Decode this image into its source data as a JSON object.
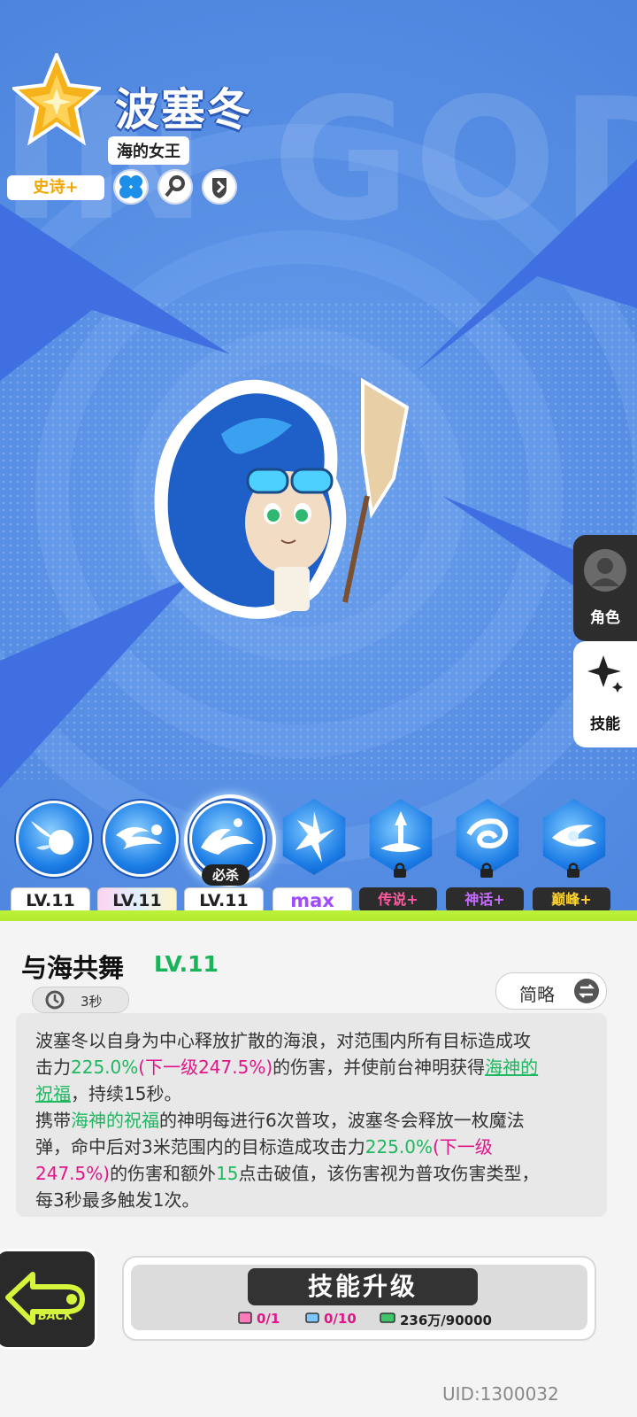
{
  "hero": {
    "name": "波塞冬",
    "title": "海的女王",
    "rarity": "史诗+",
    "watermark": "IN GOD",
    "traits": [
      "clover-icon",
      "key-icon",
      "shield-icon"
    ]
  },
  "side_tabs": [
    {
      "label": "角色",
      "active": false
    },
    {
      "label": "技能",
      "active": true
    }
  ],
  "skills": [
    {
      "icon": "comet-skill-icon",
      "shape": "circle",
      "level_label": "LV.11",
      "locked": false,
      "selected": false
    },
    {
      "icon": "wave-skill-icon",
      "shape": "circle",
      "level_label": "LV.11",
      "locked": false,
      "selected": false
    },
    {
      "icon": "sea-dance-skill-icon",
      "shape": "circle",
      "level_label": "LV.11",
      "locked": false,
      "selected": true,
      "tag": "必杀"
    },
    {
      "icon": "trident-burst-skill-icon",
      "shape": "hex",
      "level_label": "max",
      "locked": false,
      "selected": false
    },
    {
      "icon": "fountain-skill-icon",
      "shape": "hex",
      "level_label": "传说+",
      "locked": true,
      "selected": false
    },
    {
      "icon": "whirlpool-skill-icon",
      "shape": "hex",
      "level_label": "神话+",
      "locked": true,
      "selected": false
    },
    {
      "icon": "tide-orb-skill-icon",
      "shape": "hex",
      "level_label": "巅峰+",
      "locked": true,
      "selected": false
    }
  ],
  "detail": {
    "skill_name": "与海共舞",
    "skill_level": "LV.11",
    "cooldown": "3秒",
    "brief_button": "简略",
    "desc1": {
      "a": "波塞冬以自身为中心释放扩散的海浪，对范围内所有目标造成攻",
      "b": "击力",
      "c": "225.0%",
      "d": "(下一级247.5%)",
      "e": "的伤害，并使前台神明获得",
      "f": "海神的",
      "g": "祝福",
      "h": "，持续15秒。"
    },
    "desc2": {
      "a": "携带",
      "b": "海神的祝福",
      "c": "的神明每进行6次普攻，波塞冬会释放一枚魔法",
      "d": "弹，命中后对3米范围内的目标造成攻击力",
      "e": "225.0%",
      "f": "(下一级",
      "g": "247.5%)",
      "h": "的伤害和额外",
      "i": "15",
      "j": "点击破值，该伤害视为普攻伤害类型，",
      "k": "每3秒最多触发1次。"
    }
  },
  "footer": {
    "back_label": "BACK",
    "upgrade_label": "技能升级",
    "costs": [
      {
        "icon": "book-icon",
        "value": "0/1"
      },
      {
        "icon": "scroll-icon",
        "value": "0/10"
      },
      {
        "icon": "cash-icon",
        "value": "236万/90000"
      }
    ],
    "uid": "UID:1300032"
  }
}
